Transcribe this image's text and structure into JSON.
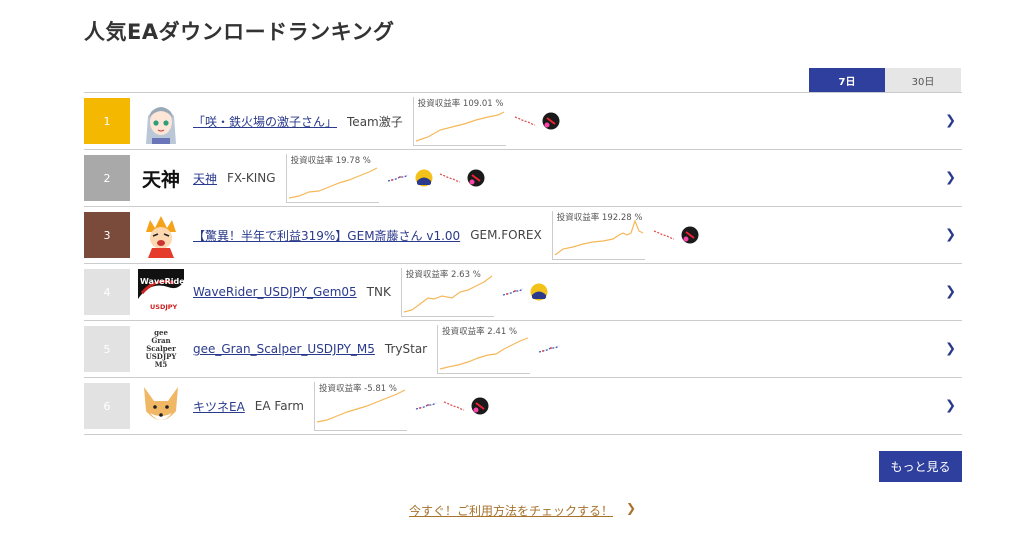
{
  "page": {
    "title": "人気EAダウンロードランキング"
  },
  "tabs": [
    {
      "label": "7日",
      "active": true
    },
    {
      "label": "30日",
      "active": false
    }
  ],
  "rows": [
    {
      "rank": "1",
      "rank_color": "#f5b800",
      "name": "「咲・鉄火場の激子さん」",
      "developer": "Team激子",
      "chart_label": "投資収益率 109.01 %",
      "badges": [
        "mini-red-down",
        "circle-dark-red"
      ]
    },
    {
      "rank": "2",
      "rank_color": "#a9a9a9",
      "name": "天神",
      "developer": "FX-KING",
      "chart_label": "投資収益率 19.78 %",
      "badges": [
        "mini-blue-up",
        "circle-yellow-blue",
        "mini-red-down",
        "circle-dark-red"
      ]
    },
    {
      "rank": "3",
      "rank_color": "#7a4a3a",
      "name": "【驚異！半年で利益319%】GEM斎藤さん v1.00",
      "developer": "GEM.FOREX",
      "chart_label": "投資収益率 192.28 %",
      "badges": [
        "mini-red-down",
        "circle-dark-red"
      ]
    },
    {
      "rank": "4",
      "rank_color": "#e2e2e2",
      "name": "WaveRider_USDJPY_Gem05",
      "developer": "TNK",
      "chart_label": "投資収益率 2.63 %",
      "badges": [
        "mini-blue-up",
        "circle-yellow-blue"
      ]
    },
    {
      "rank": "5",
      "rank_color": "#e2e2e2",
      "name": "gee_Gran_Scalper_USDJPY_M5",
      "developer": "TryStar",
      "chart_label": "投資収益率 2.41 %",
      "badges": [
        "mini-blue-up"
      ]
    },
    {
      "rank": "6",
      "rank_color": "#e2e2e2",
      "name": "キツネEA",
      "developer": "EA Farm",
      "chart_label": "投資収益率 -5.81 %",
      "badges": [
        "mini-blue-up",
        "mini-red-down",
        "circle-dark-red"
      ]
    }
  ],
  "thumb_text": {
    "row2": "天神",
    "row4_top": "WaveRider",
    "row4_bottom": "USDJPY",
    "row5": [
      "gee",
      "Gran",
      "Scalper",
      "USDJPY",
      "M5"
    ]
  },
  "buttons": {
    "more": "もっと見る"
  },
  "footer": {
    "howto": "今すぐ！ご利用方法をチェックする！"
  },
  "colors": {
    "accent": "#2f3f9e",
    "link": "#2a3a8c",
    "chart_line": "#f5b85a",
    "howto": "#a8722c"
  }
}
